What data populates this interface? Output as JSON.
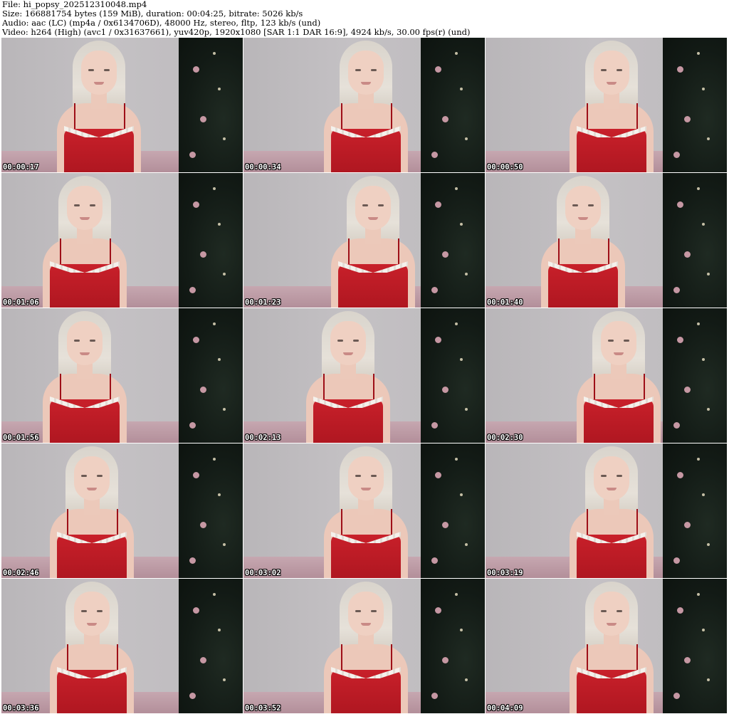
{
  "header": {
    "file_line": "File: hi_popsy_202512310048.mp4",
    "size_line": "Size: 166881754 bytes (159 MiB), duration: 00:04:25, bitrate: 5026 kb/s",
    "audio_line": "Audio: aac (LC) (mp4a / 0x6134706D), 48000 Hz, stereo, fltp, 123 kb/s (und)",
    "video_line": "Video: h264 (High) (avc1 / 0x31637661), yuv420p, 1920x1080 [SAR 1:1 DAR 16:9], 4924 kb/s, 30.00 fps(r) (und)"
  },
  "thumbnails": [
    {
      "timestamp": "00:00:17"
    },
    {
      "timestamp": "00:00:34"
    },
    {
      "timestamp": "00:00:50"
    },
    {
      "timestamp": "00:01:06"
    },
    {
      "timestamp": "00:01:23"
    },
    {
      "timestamp": "00:01:40"
    },
    {
      "timestamp": "00:01:56"
    },
    {
      "timestamp": "00:02:13"
    },
    {
      "timestamp": "00:02:30"
    },
    {
      "timestamp": "00:02:46"
    },
    {
      "timestamp": "00:03:02"
    },
    {
      "timestamp": "00:03:19"
    },
    {
      "timestamp": "00:03:36"
    },
    {
      "timestamp": "00:03:52"
    },
    {
      "timestamp": "00:04:09"
    }
  ],
  "colors": {
    "wall": "#c1bec1",
    "dress": "#b8171f",
    "lace": "#f4f1ec",
    "tree": "#141c17",
    "timestamp_text": "#ffffff"
  }
}
